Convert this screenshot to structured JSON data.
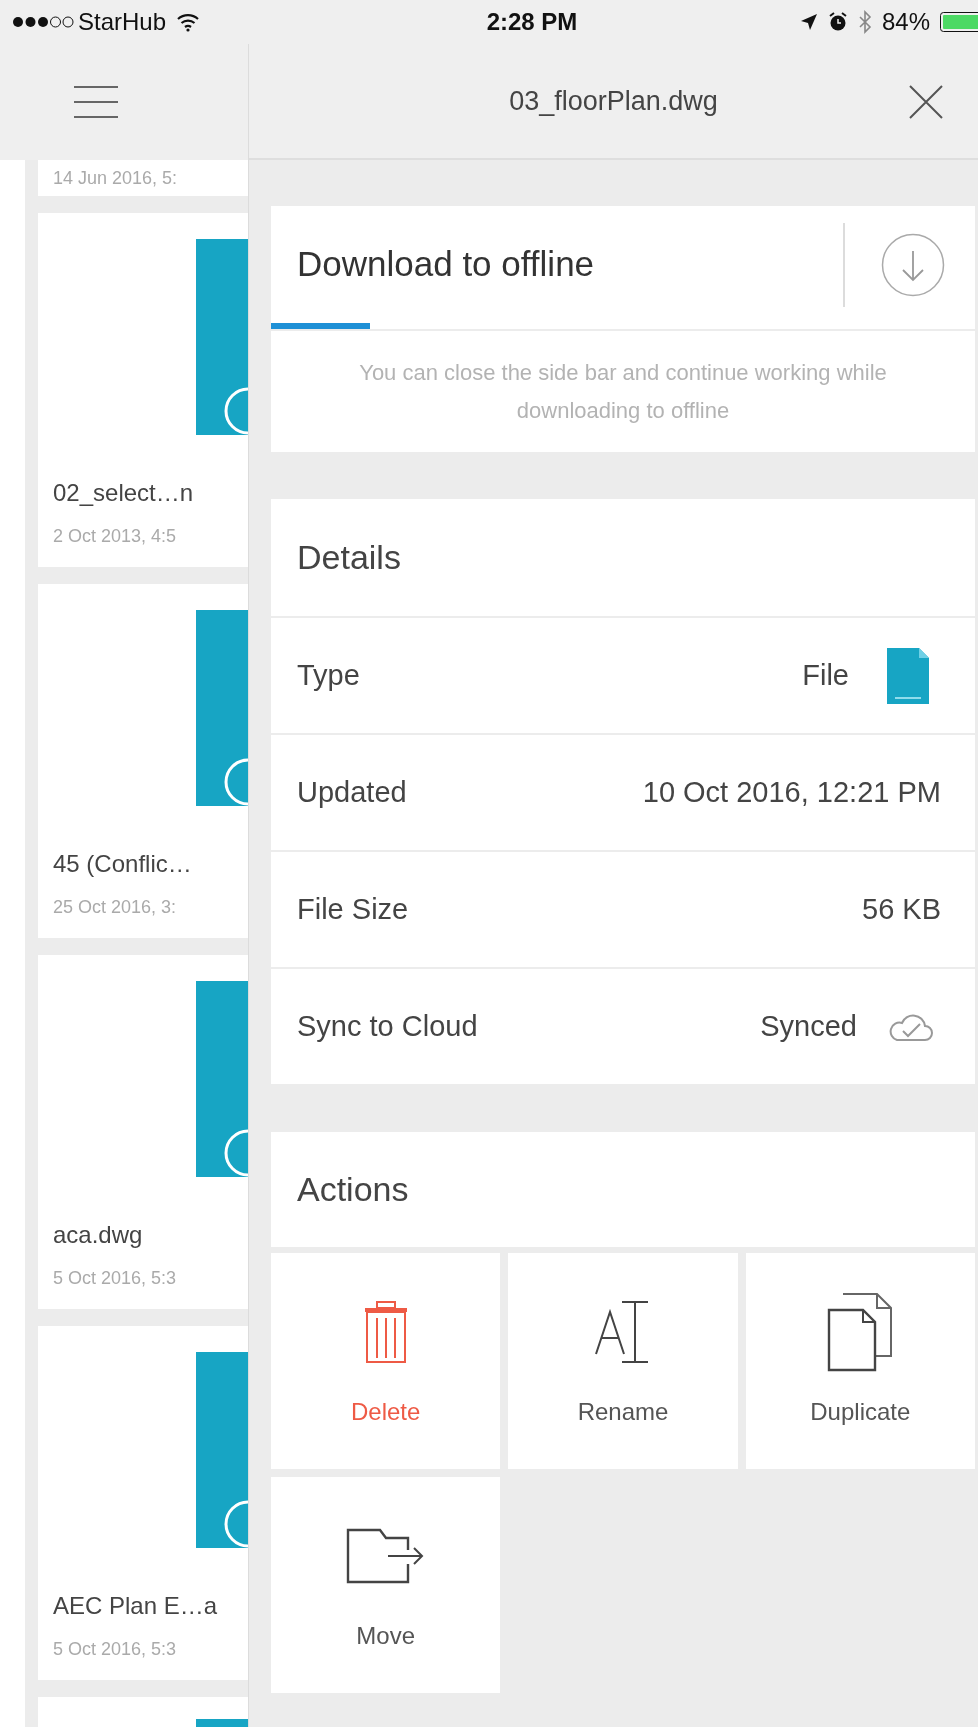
{
  "status_bar": {
    "carrier": "StarHub",
    "time": "2:28 PM",
    "battery": "84%"
  },
  "file_list": [
    {
      "date": "14 Jun 2016, 5:",
      "kind": "partial_top"
    },
    {
      "name": "02_select…n",
      "date": "2 Oct 2013, 4:5",
      "kind": "card"
    },
    {
      "name": "45 (Conflic…",
      "date": "25 Oct 2016, 3:",
      "kind": "card"
    },
    {
      "name": "aca.dwg",
      "date": "5 Oct 2016, 5:3",
      "kind": "card"
    },
    {
      "name": "AEC Plan E…a",
      "date": "5 Oct 2016, 5:3",
      "kind": "card"
    },
    {
      "kind": "partial_bottom"
    }
  ],
  "panel": {
    "title": "03_floorPlan.dwg",
    "download": {
      "label": "Download to offline",
      "level": 0.14,
      "note": "You can close the side bar and continue working while downloading to offline"
    },
    "details": {
      "heading": "Details",
      "rows": [
        {
          "label": "Type",
          "value": "File",
          "kind": "file"
        },
        {
          "label": "Updated",
          "value": "10 Oct 2016, 12:21 PM",
          "kind": "text"
        },
        {
          "label": "File Size",
          "value": "56 KB",
          "kind": "text"
        },
        {
          "label": "Sync to Cloud",
          "value": "Synced",
          "kind": "cloud"
        }
      ]
    },
    "actions": {
      "heading": "Actions",
      "items": [
        {
          "label": "Delete",
          "kind": "delete"
        },
        {
          "label": "Rename",
          "kind": "rename"
        },
        {
          "label": "Duplicate",
          "kind": "duplicate"
        },
        {
          "label": "Move",
          "kind": "move"
        }
      ]
    }
  }
}
